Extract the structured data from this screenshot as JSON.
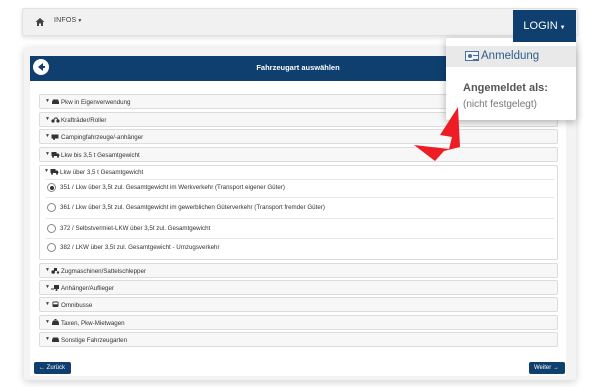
{
  "navbar": {
    "infos_label": "INFOS"
  },
  "panel": {
    "title": "Fahrzeugart auswählen"
  },
  "rows_top": [
    {
      "icon": "car-icon",
      "label": "Pkw in Eigenverwendung"
    },
    {
      "icon": "motorcycle-icon",
      "label": "Krafträder/Roller"
    },
    {
      "icon": "camper-icon",
      "label": "Campingfahrzeuge/-anhänger"
    },
    {
      "icon": "truck-icon",
      "label": "Lkw bis 3,5 t Gesamtgewicht"
    },
    {
      "icon": "truck-icon",
      "label": "Lkw über 3,5 t Gesamtgewicht"
    }
  ],
  "options": [
    {
      "label": "351 / Lkw über 3,5t zul. Gesamtgewicht im Werkverkehr (Transport eigener Güter)",
      "selected": true
    },
    {
      "label": "361 / Lkw über 3,5t zul. Gesamtgewicht im gewerblichen Güterverkehr (Transport fremder Güter)",
      "selected": false
    },
    {
      "label": "372 / Selbstvermiet-LKW über 3,5t zul. Gesamtgewicht",
      "selected": false
    },
    {
      "label": "382 / LKW über 3,5t zul. Gesamtgewicht - Umzugsverkehr",
      "selected": false
    }
  ],
  "rows_bottom": [
    {
      "icon": "tractor-icon",
      "label": "Zugmaschinen/Sattelschlepper"
    },
    {
      "icon": "trailer-icon",
      "label": "Anhänger/Auflieger"
    },
    {
      "icon": "bus-icon",
      "label": "Omnibusse"
    },
    {
      "icon": "taxi-icon",
      "label": "Taxen, Pkw-Mietwagen"
    },
    {
      "icon": "car-icon",
      "label": "Sonstige Fahrzeugarten"
    }
  ],
  "buttons": {
    "back": "Zurück",
    "next": "Weiter"
  },
  "login": {
    "button_label": "LOGIN",
    "anmeldung": "Anmeldung",
    "angemeldet_als": "Angemeldet als:",
    "status": "(nicht festgelegt)"
  },
  "colors": {
    "brand": "#0e3f6e",
    "arrow": "#ee1c25"
  }
}
